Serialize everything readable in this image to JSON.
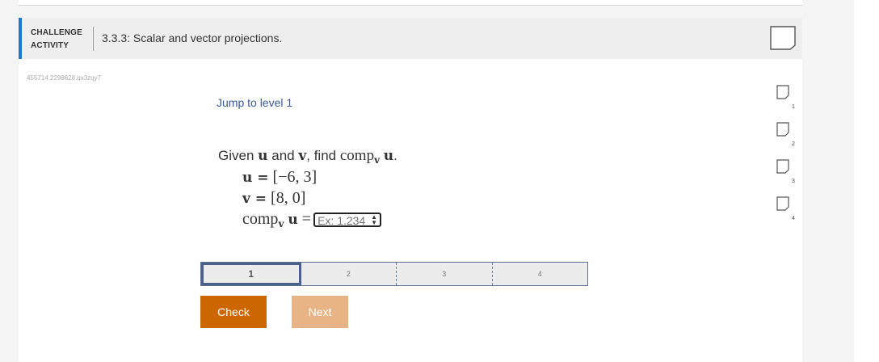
{
  "header": {
    "label_line1": "CHALLENGE",
    "label_line2": "ACTIVITY",
    "title": "3.3.3: Scalar and vector projections."
  },
  "seed": "455714.2298628.qx3zqy7",
  "jump_link": "Jump to level 1",
  "problem": {
    "given_word": "Given",
    "u": "u",
    "and_word": "and",
    "v": "v",
    "find_word": ", find",
    "comp": "comp",
    "period": ".",
    "u_value": "[−6, 3]",
    "v_value": "[8, 0]",
    "eq_u": "u =",
    "eq_v": "v =",
    "eq_comp_rhs": "=",
    "answer_placeholder": "Ex: 1.234"
  },
  "levels": [
    "1",
    "2",
    "3",
    "4"
  ],
  "active_level": 1,
  "buttons": {
    "check": "Check",
    "next": "Next"
  },
  "side_questions": [
    "1",
    "2",
    "3",
    "4"
  ],
  "colors": {
    "accent": "#1e77c8",
    "check": "#cc6600",
    "next": "#e8b486",
    "link": "#3a5a9a"
  }
}
